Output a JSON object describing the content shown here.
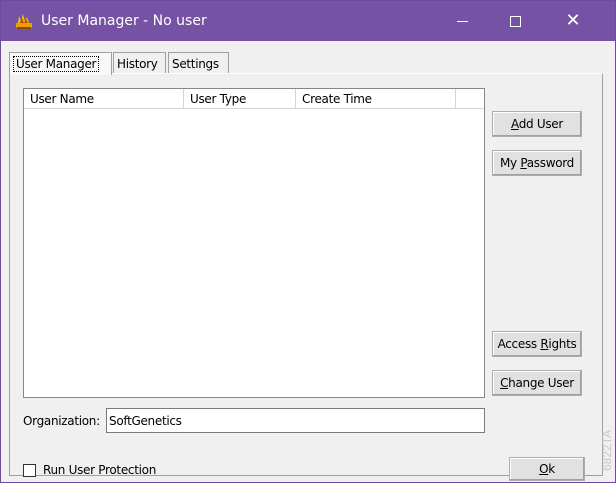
{
  "window": {
    "title": "User Manager - No user",
    "app_icon": "softgenetics-flame-icon",
    "controls": {
      "minimize": "minimize-icon",
      "maximize": "maximize-icon",
      "close": "✕"
    },
    "colors": {
      "titlebar": "#7652a4",
      "title_text": "#ffffff"
    }
  },
  "tabs": [
    {
      "label": "User Manager",
      "active": true
    },
    {
      "label": "History",
      "active": false
    },
    {
      "label": "Settings",
      "active": false
    }
  ],
  "user_list": {
    "columns": [
      "User Name",
      "User Type",
      "Create Time",
      ""
    ],
    "rows": []
  },
  "buttons": {
    "add_user": {
      "pre": "",
      "accel": "A",
      "post": "dd User"
    },
    "my_password": {
      "pre": "My ",
      "accel": "P",
      "post": "assword"
    },
    "access_rights": {
      "pre": "Access ",
      "accel": "R",
      "post": "ights"
    },
    "change_user": {
      "pre": "",
      "accel": "C",
      "post": "hange User"
    },
    "ok": {
      "pre": "",
      "accel": "O",
      "post": "k"
    }
  },
  "organization": {
    "label": "Organization:",
    "value": "SoftGenetics"
  },
  "run_user_protection": {
    "label": "Run User Protection",
    "checked": false
  },
  "watermark": "6822TA"
}
